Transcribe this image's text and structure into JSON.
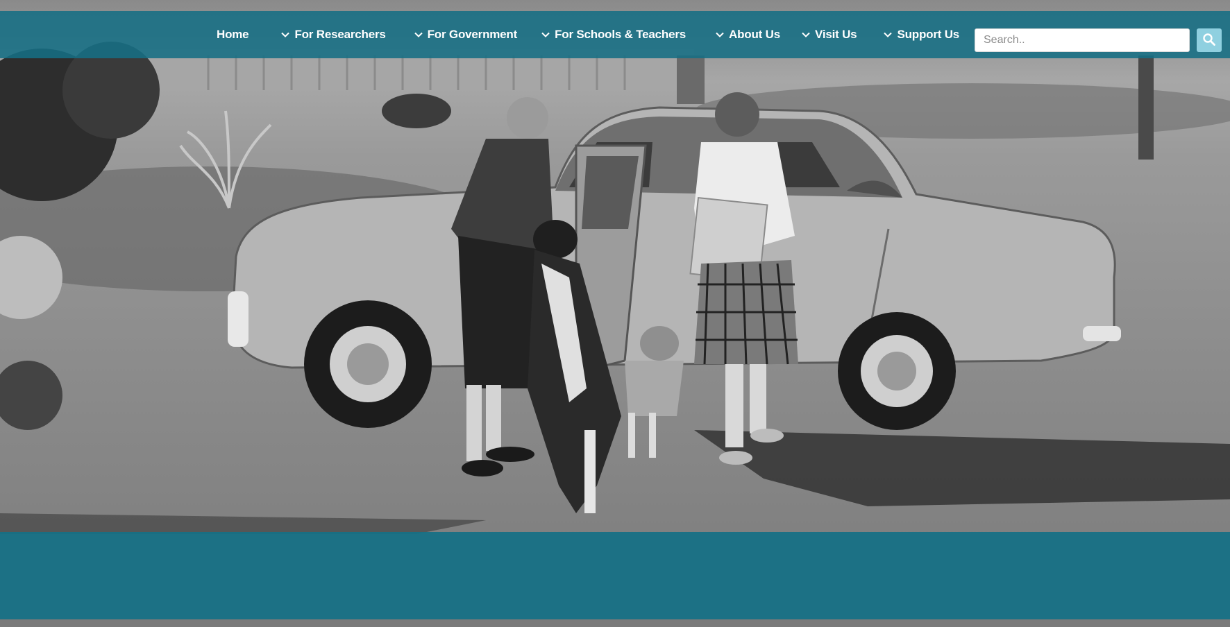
{
  "nav": {
    "items": [
      {
        "label": "Home",
        "dropdown": false
      },
      {
        "label": "For Researchers",
        "dropdown": true
      },
      {
        "label": "For Government",
        "dropdown": true
      },
      {
        "label": "For Schools & Teachers",
        "dropdown": true
      },
      {
        "label": "About Us",
        "dropdown": true
      },
      {
        "label": "Visit Us",
        "dropdown": true
      },
      {
        "label": "Support Us",
        "dropdown": true
      }
    ]
  },
  "search": {
    "placeholder": "Search..",
    "icon": "search-icon"
  },
  "colors": {
    "header_bg": "#166e84",
    "search_button": "#8fd0e0",
    "band_bg": "#147086"
  },
  "hero": {
    "description_icon": "photo-black-and-white"
  }
}
